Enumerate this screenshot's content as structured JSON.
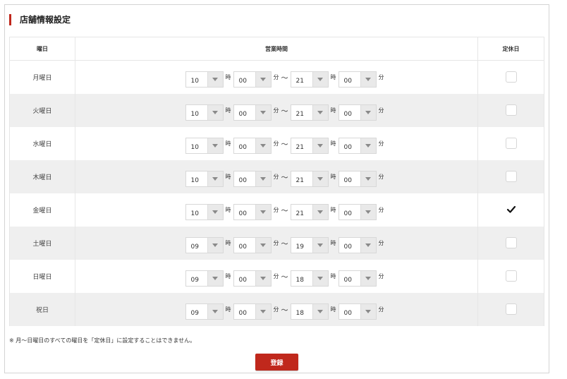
{
  "panel": {
    "title": "店舗情報設定"
  },
  "table": {
    "headers": {
      "day": "曜日",
      "hours": "営業時間",
      "holiday": "定休日"
    },
    "units": {
      "hour": "時",
      "minute": "分",
      "tilde": "～"
    },
    "rows": [
      {
        "day": "月曜日",
        "open_h": "10",
        "open_m": "00",
        "close_h": "21",
        "close_m": "00",
        "holiday": false
      },
      {
        "day": "火曜日",
        "open_h": "10",
        "open_m": "00",
        "close_h": "21",
        "close_m": "00",
        "holiday": false
      },
      {
        "day": "水曜日",
        "open_h": "10",
        "open_m": "00",
        "close_h": "21",
        "close_m": "00",
        "holiday": false
      },
      {
        "day": "木曜日",
        "open_h": "10",
        "open_m": "00",
        "close_h": "21",
        "close_m": "00",
        "holiday": false
      },
      {
        "day": "金曜日",
        "open_h": "10",
        "open_m": "00",
        "close_h": "21",
        "close_m": "00",
        "holiday": true
      },
      {
        "day": "土曜日",
        "open_h": "09",
        "open_m": "00",
        "close_h": "19",
        "close_m": "00",
        "holiday": false
      },
      {
        "day": "日曜日",
        "open_h": "09",
        "open_m": "00",
        "close_h": "18",
        "close_m": "00",
        "holiday": false
      },
      {
        "day": "祝日",
        "open_h": "09",
        "open_m": "00",
        "close_h": "18",
        "close_m": "00",
        "holiday": false
      }
    ]
  },
  "note": "※ 月～日曜日のすべての曜日を「定休日」に設定することはできません。",
  "submit": {
    "label": "登録"
  },
  "colors": {
    "accent": "#c0281c",
    "row_alt": "#efefef"
  }
}
